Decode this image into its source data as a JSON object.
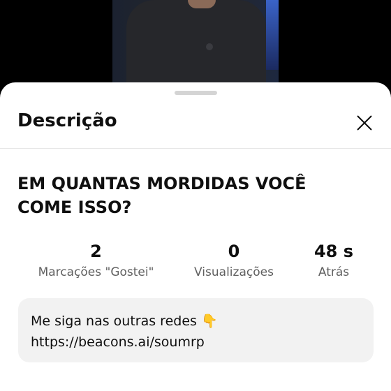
{
  "sheet": {
    "title": "Descrição",
    "close_icon": "close-icon"
  },
  "video": {
    "title": "EM QUANTAS MORDIDAS VOCÊ COME ISSO?"
  },
  "stats": [
    {
      "value": "2",
      "label": "Marcações \"Gostei\""
    },
    {
      "value": "0",
      "label": "Visualizações"
    },
    {
      "value": "48 s",
      "label": "Atrás"
    }
  ],
  "description": {
    "line1": "Me siga nas outras redes 👇",
    "line2": "https://beacons.ai/soumrp"
  }
}
